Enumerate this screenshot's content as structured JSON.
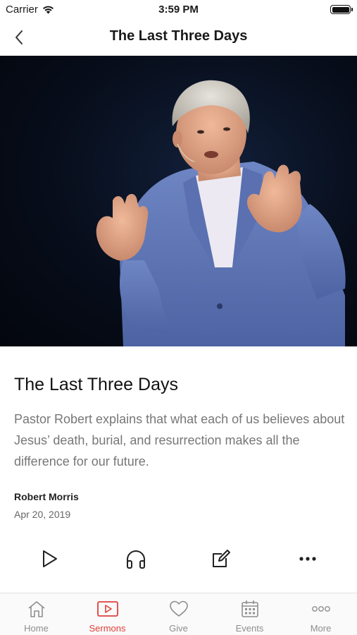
{
  "status_bar": {
    "carrier": "Carrier",
    "time": "3:59 PM"
  },
  "nav": {
    "title": "The Last Three Days",
    "back_icon": "chevron-left-icon"
  },
  "sermon": {
    "title": "The Last Three Days",
    "description": "Pastor Robert explains that what each of us believes about Jesus’ death, burial, and resurrection makes all the difference for our future.",
    "speaker": "Robert Morris",
    "date": "Apr 20, 2019"
  },
  "actions": [
    {
      "icon": "play-icon"
    },
    {
      "icon": "headphones-icon"
    },
    {
      "icon": "notes-icon"
    },
    {
      "icon": "more-icon"
    }
  ],
  "tabs": [
    {
      "label": "Home",
      "icon": "home-icon",
      "active": false
    },
    {
      "label": "Sermons",
      "icon": "video-icon",
      "active": true
    },
    {
      "label": "Give",
      "icon": "heart-icon",
      "active": false
    },
    {
      "label": "Events",
      "icon": "calendar-icon",
      "active": false
    },
    {
      "label": "More",
      "icon": "more-dots-icon",
      "active": false
    }
  ],
  "colors": {
    "accent": "#e0403a",
    "inactive": "#8e8e8e",
    "hero_bg": "#070d1a"
  }
}
